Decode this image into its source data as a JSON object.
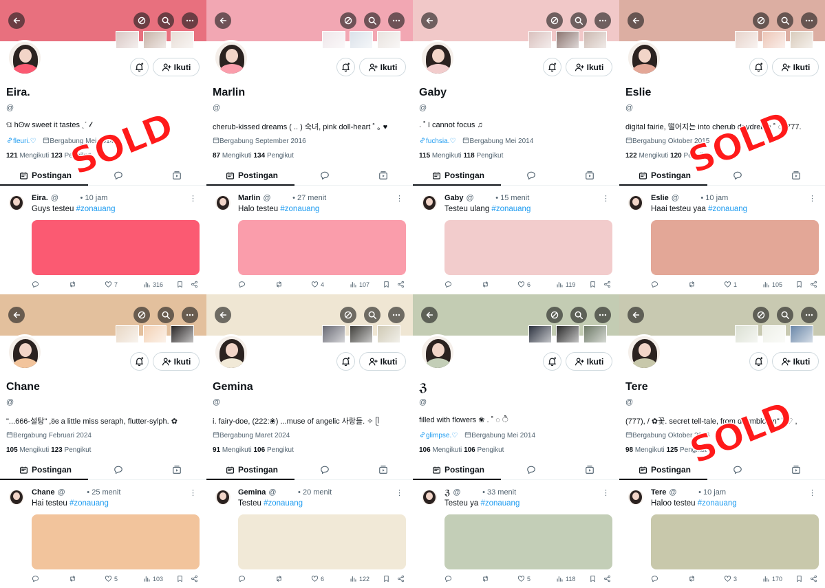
{
  "labels": {
    "follow": "Ikuti",
    "posts_tab": "Postingan",
    "following_label": "Mengikuti",
    "followers_label": "Pengikut",
    "sold": "SOLD"
  },
  "profiles": [
    {
      "name": "Eira.",
      "handle": "@",
      "bio": "ଘ hʘw   sweet   it   tastes   ˎˊ  𝓁",
      "link": "fleuri.♡",
      "joined": "Bergabung Mei 2014",
      "following": "121",
      "followers": "123",
      "post_name": "Eira.",
      "post_handle": "@",
      "post_time": "10 jam",
      "post_text": "Guys testeu",
      "hashtag": "#zonauang",
      "replies": "",
      "retweets": "",
      "likes": "7",
      "views": "316",
      "banner_color": "#e8707e",
      "swatch_color": "#fb5a72",
      "sold": true
    },
    {
      "name": "Marlin",
      "handle": "@",
      "bio": "cherub-kissed dreams ( .. ) 숙녀, pink doll-heart ˚ ｡ ♥",
      "link": "",
      "joined": "Bergabung September 2016",
      "following": "87",
      "followers": "134",
      "post_name": "Marlin",
      "post_handle": "@",
      "post_time": "27 menit",
      "post_text": "Halo testeu",
      "hashtag": "#zonauang",
      "replies": "",
      "retweets": "",
      "likes": "4",
      "views": "107",
      "banner_color": "#f2a7b3",
      "swatch_color": "#fa9dab",
      "sold": false
    },
    {
      "name": "Gaby",
      "handle": "@",
      "bio": "  .  ˚   I   cannot   focus   ♫",
      "link": "fuchsia.♡",
      "joined": "Bergabung Mei 2014",
      "following": "115",
      "followers": "118",
      "post_name": "Gaby",
      "post_handle": "@",
      "post_time": "15 menit",
      "post_text": "Testeu ulang",
      "hashtag": "#zonauang",
      "replies": "",
      "retweets": "",
      "likes": "6",
      "views": "119",
      "banner_color": "#f1c8c8",
      "swatch_color": "#f2cccc",
      "sold": false
    },
    {
      "name": "Eslie",
      "handle": "@",
      "bio": "digital fairie, 떨어지는 into cherub daydream ˚ ◌. 777.",
      "link": "",
      "joined": "Bergabung Oktober 2015",
      "following": "122",
      "followers": "120",
      "post_name": "Eslie",
      "post_handle": "@",
      "post_time": "10 jam",
      "post_text": "Haai testeu yaa",
      "hashtag": "#zonauang",
      "replies": "",
      "retweets": "",
      "likes": "1",
      "views": "105",
      "banner_color": "#dcaea2",
      "swatch_color": "#e3a797",
      "sold": true
    },
    {
      "name": "Chane",
      "handle": "@",
      "bio": "\"...666-설탕\" ,ʚ̈ɞ   a little miss seraph, flutter-sylph. ✿",
      "link": "",
      "joined": "Bergabung Februari 2024",
      "following": "105",
      "followers": "123",
      "post_name": "Chane",
      "post_handle": "@",
      "post_time": "25 menit",
      "post_text": "Hai testeu",
      "hashtag": "#zonauang",
      "replies": "",
      "retweets": "",
      "likes": "5",
      "views": "103",
      "banner_color": "#e3c09d",
      "swatch_color": "#f2c49c",
      "sold": false
    },
    {
      "name": "Gemina",
      "handle": "@",
      "bio": "i. fairy-doe, (222:❀) ...muse of angelic 사랑들. ✧ ᥫ",
      "link": "",
      "joined": "Bergabung Maret 2024",
      "following": "91",
      "followers": "106",
      "post_name": "Gemina",
      "post_handle": "@",
      "post_time": "20 menit",
      "post_text": "Testeu",
      "hashtag": "#zonauang",
      "replies": "",
      "retweets": "",
      "likes": "6",
      "views": "122",
      "banner_color": "#efe6d3",
      "swatch_color": "#f1e9d7",
      "sold": false
    },
    {
      "name": "ℨ",
      "handle": "@",
      "bio": "filled   with   flowers   ❀  .   ˚ ◌ ੈ",
      "link": "glimpse.♡",
      "joined": "Bergabung Mei 2014",
      "following": "106",
      "followers": "106",
      "post_name": "ℨ",
      "post_handle": "@",
      "post_time": "33 menit",
      "post_text": "Testeu ya",
      "hashtag": "#zonauang",
      "replies": "",
      "retweets": "",
      "likes": "5",
      "views": "118",
      "banner_color": "#c3ccb3",
      "swatch_color": "#c3ceb7",
      "sold": false
    },
    {
      "name": "Tere",
      "handle": "@",
      "bio": "(777), / ✿꽃. secret tell-tale, from daymbloom\" ˚ ♡ ,",
      "link": "",
      "joined": "Bergabung Oktober 2016",
      "following": "98",
      "followers": "125",
      "post_name": "Tere",
      "post_handle": "@",
      "post_time": "10 jam",
      "post_text": "Haloo testeu",
      "hashtag": "#zonauang",
      "replies": "",
      "retweets": "",
      "likes": "3",
      "views": "170",
      "banner_color": "#c8c9b1",
      "swatch_color": "#c8c8ab",
      "sold": true
    }
  ]
}
